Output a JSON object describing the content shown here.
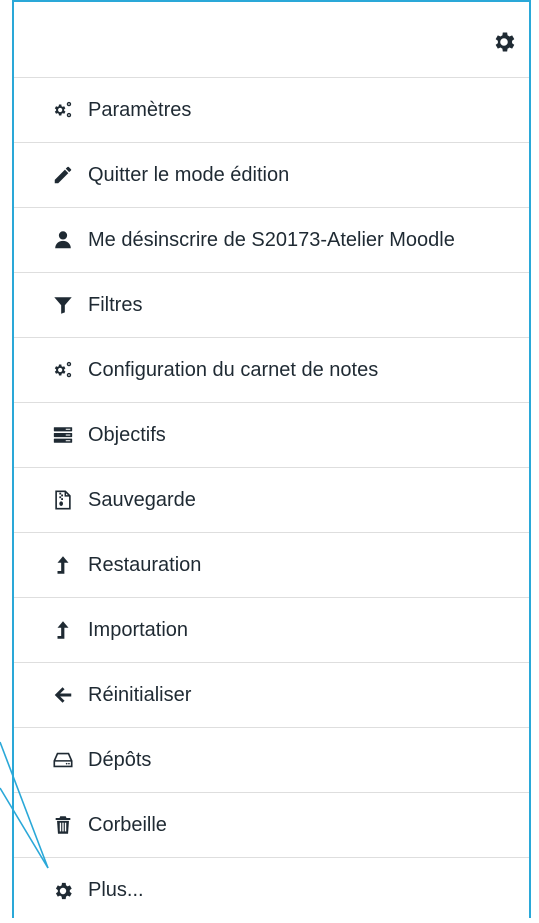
{
  "header": {
    "icon": "gear-icon"
  },
  "items": [
    {
      "label": "Paramètres",
      "icon": "cogs-icon"
    },
    {
      "label": "Quitter le mode édition",
      "icon": "pencil-icon"
    },
    {
      "label": "Me désinscrire de S20173-Atelier Moodle",
      "icon": "user-icon"
    },
    {
      "label": "Filtres",
      "icon": "filter-icon"
    },
    {
      "label": "Configuration du carnet de notes",
      "icon": "cogs-icon"
    },
    {
      "label": "Objectifs",
      "icon": "list-icon"
    },
    {
      "label": "Sauvegarde",
      "icon": "file-archive-icon"
    },
    {
      "label": "Restauration",
      "icon": "upload-icon"
    },
    {
      "label": "Importation",
      "icon": "upload-icon"
    },
    {
      "label": "Réinitialiser",
      "icon": "arrow-left-icon"
    },
    {
      "label": "Dépôts",
      "icon": "hdd-icon"
    },
    {
      "label": "Corbeille",
      "icon": "trash-icon"
    },
    {
      "label": "Plus...",
      "icon": "gear-icon"
    }
  ],
  "colors": {
    "accent": "#2aa8d8",
    "text": "#1f2a33",
    "divider": "#dedede"
  }
}
